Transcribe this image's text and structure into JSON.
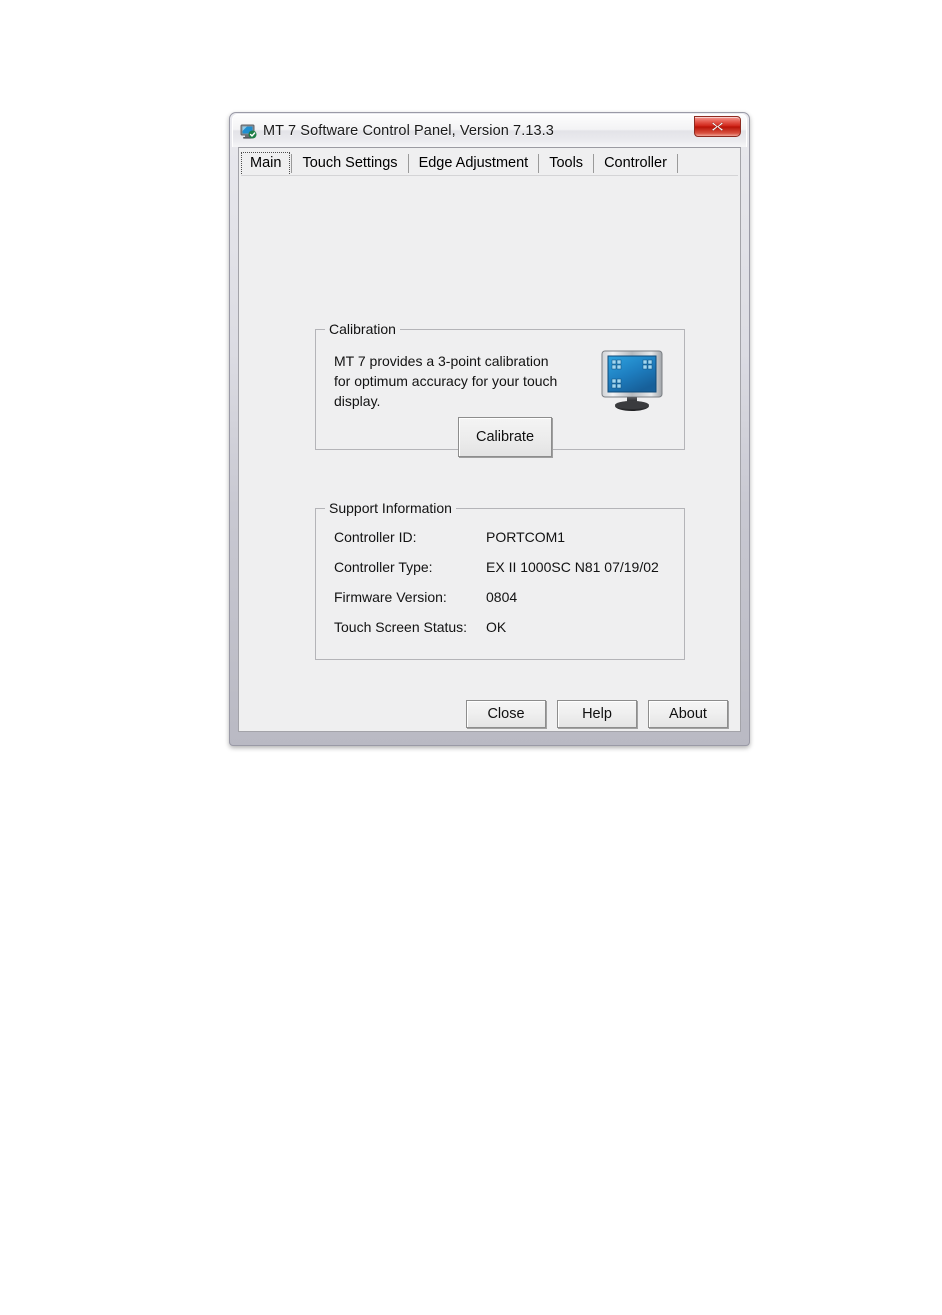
{
  "window": {
    "title": "MT 7 Software Control Panel, Version 7.13.3",
    "icon": "monitor-app-icon",
    "close_icon": "close-icon",
    "close_button_glyph": "x",
    "accent_close_color": "#cf2418",
    "titlebar_color": "#f1f1f4",
    "client_bg_color": "#efeff0"
  },
  "tabs": [
    {
      "label": "Main",
      "selected": true
    },
    {
      "label": "Touch Settings",
      "selected": false
    },
    {
      "label": "Edge Adjustment",
      "selected": false
    },
    {
      "label": "Tools",
      "selected": false
    },
    {
      "label": "Controller",
      "selected": false
    }
  ],
  "calibration": {
    "group_title": "Calibration",
    "description": "MT 7 provides a 3-point calibration for optimum accuracy for your touch display.",
    "button_label": "Calibrate",
    "icon": "touch-monitor-icon",
    "icon_screen_color": "#1f7fc4",
    "icon_bezel_color": "#b9bcc0"
  },
  "support": {
    "group_title": "Support Information",
    "rows": [
      {
        "label": "Controller ID:",
        "value": "PORTCOM1"
      },
      {
        "label": "Controller Type:",
        "value": "EX II 1000SC N81 07/19/02"
      },
      {
        "label": "Firmware Version:",
        "value": "0804"
      },
      {
        "label": "Touch Screen Status:",
        "value": "OK"
      }
    ]
  },
  "footer": {
    "close_label": "Close",
    "help_label": "Help",
    "about_label": "About"
  }
}
